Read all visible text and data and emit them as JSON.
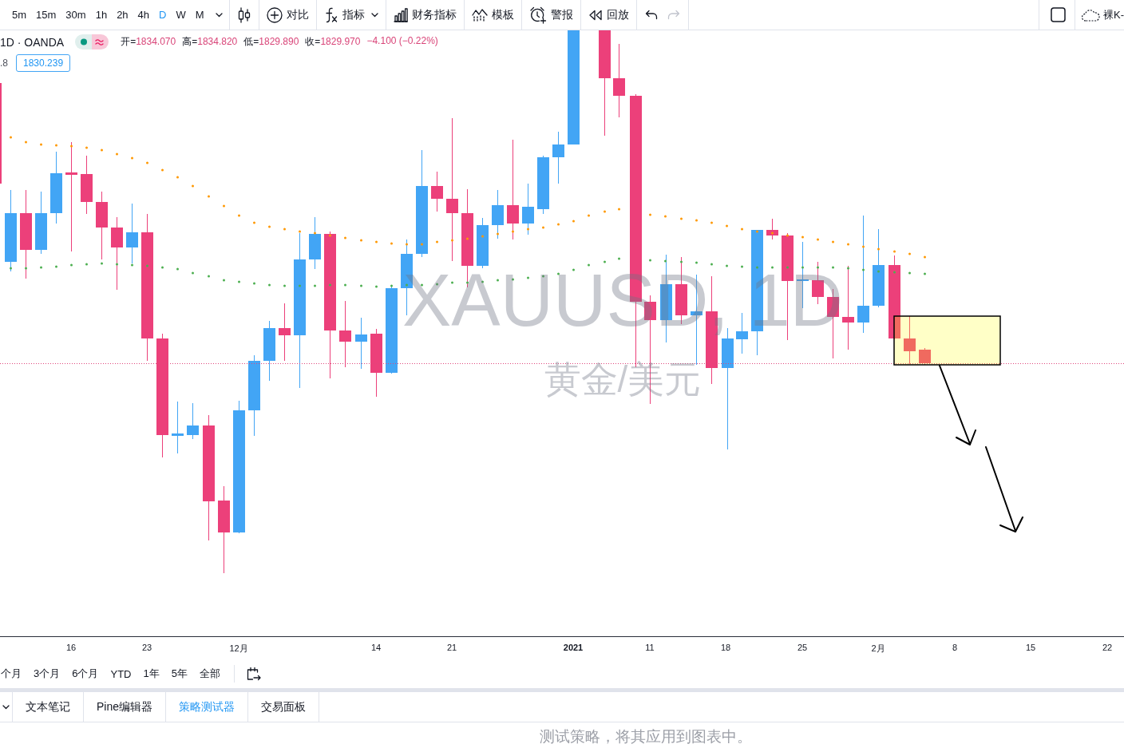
{
  "toolbar": {
    "intervals": [
      {
        "label": "5m",
        "selected": false
      },
      {
        "label": "15m",
        "selected": false
      },
      {
        "label": "30m",
        "selected": false
      },
      {
        "label": "1h",
        "selected": false
      },
      {
        "label": "2h",
        "selected": false
      },
      {
        "label": "4h",
        "selected": false
      },
      {
        "label": "D",
        "selected": true
      },
      {
        "label": "W",
        "selected": false
      },
      {
        "label": "M",
        "selected": false
      }
    ],
    "tools": [
      {
        "kind": "chart-type",
        "dropdown": false
      },
      {
        "kind": "compare",
        "label": "对比",
        "dropdown": false
      },
      {
        "kind": "indicators",
        "label": "指标",
        "dropdown": true
      },
      {
        "kind": "financials",
        "label": "财务指标",
        "dropdown": false
      },
      {
        "kind": "templates",
        "label": "模板",
        "dropdown": false
      },
      {
        "kind": "alert",
        "label": "警报",
        "dropdown": false
      },
      {
        "kind": "replay",
        "label": "回放",
        "dropdown": false
      }
    ],
    "history": [
      {
        "kind": "undo",
        "disabled": false
      },
      {
        "kind": "redo",
        "disabled": true
      }
    ],
    "layout": {
      "label": "裸K-"
    }
  },
  "legend": {
    "symbol": "1D · OANDA",
    "ohlc": [
      {
        "label": "开=",
        "value": "1834.070"
      },
      {
        "label": "高=",
        "value": "1834.820"
      },
      {
        "label": "低=",
        "value": "1829.890"
      },
      {
        "label": "收=",
        "value": "1829.970"
      }
    ],
    "change": "−4.100 (−0.22%)",
    "indicator_value": ".8",
    "price_label": "1830.239"
  },
  "chart": {
    "watermark_symbol": "XAUUSD, 1D",
    "watermark_description": "黄金/美元"
  },
  "time_axis": [
    {
      "label": "16",
      "kind": "day"
    },
    {
      "label": "23",
      "kind": "day"
    },
    {
      "label": "12月",
      "kind": "month"
    },
    {
      "label": "14",
      "kind": "day"
    },
    {
      "label": "21",
      "kind": "day"
    },
    {
      "label": "2021",
      "kind": "year"
    },
    {
      "label": "11",
      "kind": "day"
    },
    {
      "label": "18",
      "kind": "day"
    },
    {
      "label": "25",
      "kind": "day"
    },
    {
      "label": "2月",
      "kind": "month"
    },
    {
      "label": "8",
      "kind": "day"
    },
    {
      "label": "15",
      "kind": "day"
    },
    {
      "label": "22",
      "kind": "day"
    }
  ],
  "ranges": [
    {
      "label": "个月",
      "selected": false
    },
    {
      "label": "3个月",
      "selected": false
    },
    {
      "label": "6个月",
      "selected": false
    },
    {
      "label": "YTD",
      "selected": false
    },
    {
      "label": "1年",
      "selected": false
    },
    {
      "label": "5年",
      "selected": false
    },
    {
      "label": "全部",
      "selected": false
    }
  ],
  "bottom_panel": {
    "tabs": [
      {
        "label": "文本笔记",
        "selected": false
      },
      {
        "label": "Pine编辑器",
        "selected": false
      },
      {
        "label": "策略测试器",
        "selected": true
      },
      {
        "label": "交易面板",
        "selected": false
      }
    ],
    "message": "测试策略，将其应用到图表中。"
  }
}
